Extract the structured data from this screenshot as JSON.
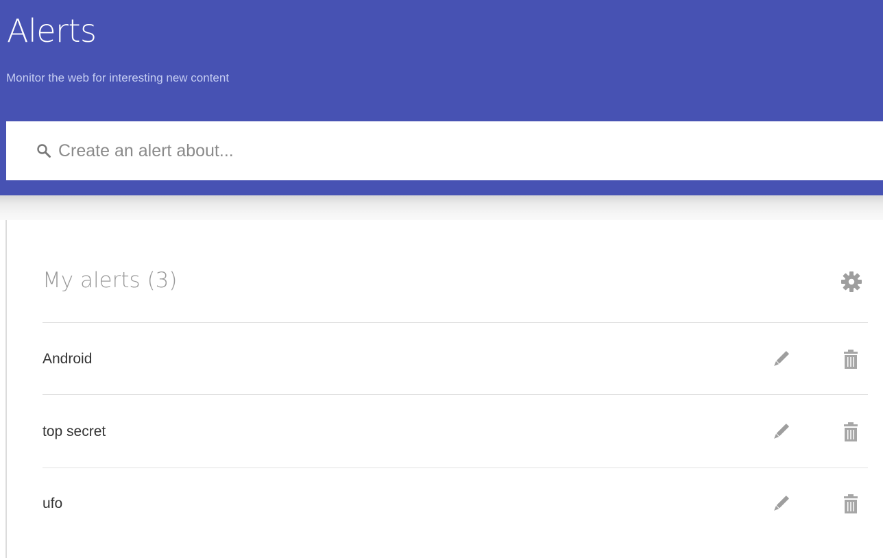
{
  "header": {
    "title": "Alerts",
    "subtitle": "Monitor the web for interesting new content",
    "background_color": "#4752b3"
  },
  "search": {
    "placeholder": "Create an alert about...",
    "value": "",
    "icon": "search-icon"
  },
  "my_alerts": {
    "title": "My alerts (3)",
    "settings_icon": "gear-icon",
    "items": [
      {
        "label": "Android",
        "edit_icon": "pencil-icon",
        "delete_icon": "trash-icon"
      },
      {
        "label": "top secret",
        "edit_icon": "pencil-icon",
        "delete_icon": "trash-icon"
      },
      {
        "label": "ufo",
        "edit_icon": "pencil-icon",
        "delete_icon": "trash-icon"
      }
    ]
  }
}
